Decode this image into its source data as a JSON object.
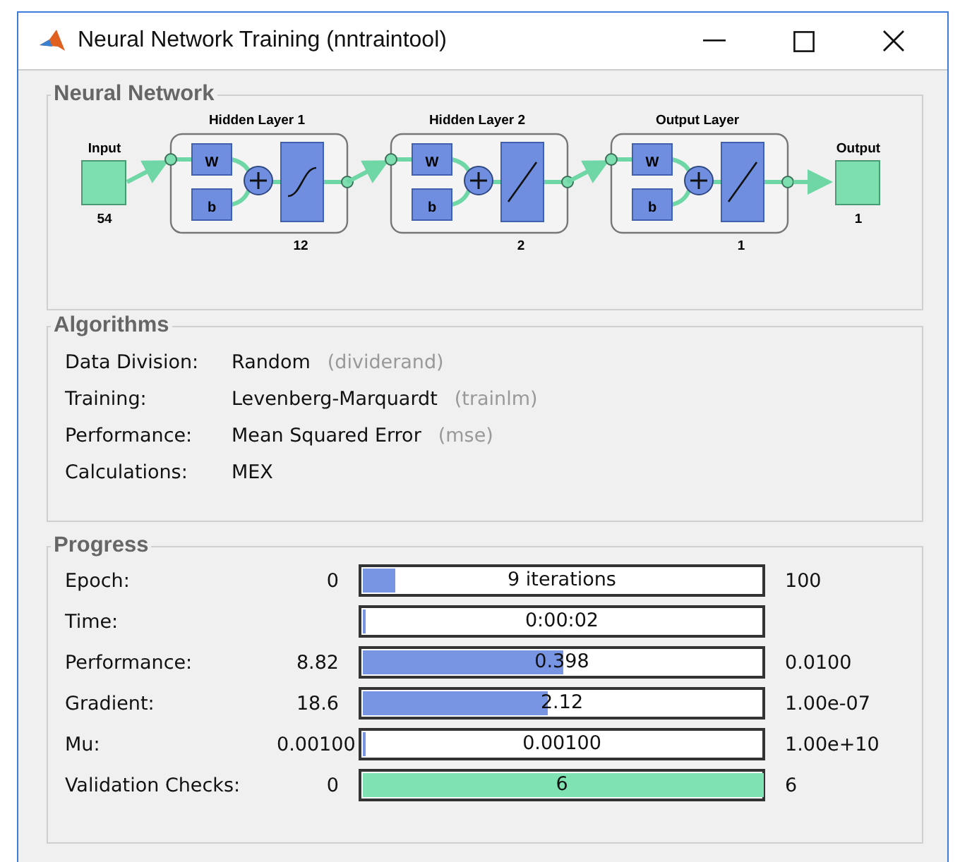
{
  "window": {
    "title": "Neural Network Training (nntraintool)"
  },
  "network": {
    "title": "Neural Network",
    "input": {
      "label": "Input",
      "size": "54"
    },
    "output": {
      "label": "Output",
      "size": "1"
    },
    "layers": [
      {
        "name": "Hidden Layer 1",
        "size": "12",
        "weight": "W",
        "bias": "b",
        "kind": "sigmoid"
      },
      {
        "name": "Hidden Layer 2",
        "size": "2",
        "weight": "W",
        "bias": "b",
        "kind": "linear"
      },
      {
        "name": "Output Layer",
        "size": "1",
        "weight": "W",
        "bias": "b",
        "kind": "linear"
      }
    ]
  },
  "algorithms": {
    "title": "Algorithms",
    "rows": [
      {
        "label": "Data Division:",
        "value": "Random",
        "function": "(dividerand)"
      },
      {
        "label": "Training:",
        "value": "Levenberg-Marquardt",
        "function": "(trainlm)"
      },
      {
        "label": "Performance:",
        "value": "Mean Squared Error",
        "function": "(mse)"
      },
      {
        "label": "Calculations:",
        "value": "MEX"
      }
    ]
  },
  "progress": {
    "title": "Progress",
    "rows": [
      {
        "label": "Epoch:",
        "start": "0",
        "value": "9 iterations",
        "end": "100",
        "level": 0.08,
        "kind": "measure"
      },
      {
        "label": "Time:",
        "value": "0:00:02",
        "level": 0,
        "kind": "measure"
      },
      {
        "label": "Performance:",
        "start": "8.82",
        "value": "0.398",
        "end": "0.0100",
        "level": 0.5,
        "kind": "measure"
      },
      {
        "label": "Gradient:",
        "start": "18.6",
        "value": "2.12",
        "end": "1.00e-07",
        "level": 0.46,
        "kind": "measure"
      },
      {
        "label": "Mu:",
        "start": "0.00100",
        "value": "0.00100",
        "end": "1.00e+10",
        "level": 0,
        "kind": "measure"
      },
      {
        "label": "Validation Checks:",
        "start": "0",
        "value": "6",
        "end": "6",
        "level": 1,
        "kind": "check"
      }
    ]
  }
}
